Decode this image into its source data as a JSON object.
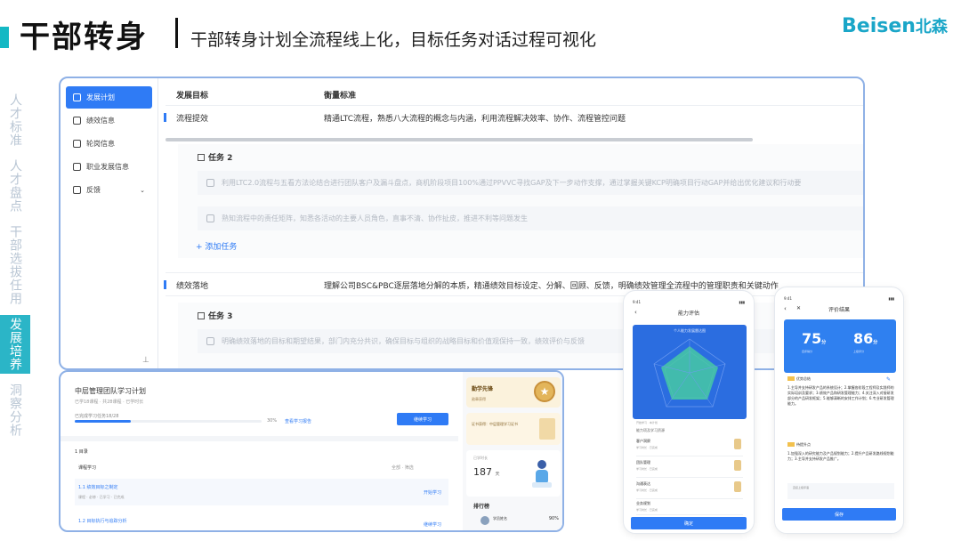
{
  "header": {
    "title": "干部转身",
    "subtitle": "干部转身计划全流程线上化，目标任务对话过程可视化",
    "logo_en": "Beisen",
    "logo_cn": "北森"
  },
  "vnav": [
    {
      "label": "人才标准",
      "active": false
    },
    {
      "label": "人才盘点",
      "active": false
    },
    {
      "label": "干部选拔任用",
      "active": false
    },
    {
      "label": "发展培养",
      "active": true
    },
    {
      "label": "洞察分析",
      "active": false
    }
  ],
  "main": {
    "sidebar": [
      {
        "label": "发展计划",
        "icon": "target-icon",
        "active": true
      },
      {
        "label": "绩效信息",
        "icon": "chart-icon",
        "active": false
      },
      {
        "label": "轮岗信息",
        "icon": "rotate-icon",
        "active": false
      },
      {
        "label": "职业发展信息",
        "icon": "career-icon",
        "active": false
      },
      {
        "label": "反馈",
        "icon": "feedback-icon",
        "active": false
      }
    ],
    "columns": {
      "goal": "发展目标",
      "standard": "衡量标准"
    },
    "rows": [
      {
        "goal": "流程提效",
        "standard": "精通LTC流程，熟悉八大流程的概念与内涵，利用流程解决效率、协作、流程管控问题",
        "task_title": "任务 2",
        "tasks": [
          "利用LTC2.0流程与五看方法论结合进行团队客户及漏斗盘点，商机阶段项目100%通过PPVVC寻找GAP及下一步动作支撑，通过掌握关键KCP明确项目行动GAP并给出优化建议和行动要",
          "熟知流程中的责任矩阵，知悉各活动的主要人员角色，直事不清、协作扯皮，推进不利等问题发生"
        ],
        "add_task": "添加任务"
      },
      {
        "goal": "绩效落地",
        "standard": "理解公司BSC&PBC逐层落地分解的本质，精通绩效目标设定、分解、回顾、反馈，明确绩效管理全流程中的管理职责和关键动作",
        "task_title": "任务 3",
        "tasks": [
          "明确绩效落地的目标和期望结果，部门内充分共识，确保目标与组织的战略目标和价值观保持一致，绩效评价与反馈"
        ]
      }
    ]
  },
  "plan": {
    "title": "中层管理团队学习计划",
    "meta": "已学18课程 · 共28课程 · 已学时长",
    "progress_label": "已完成学习任务18/28",
    "progress": 0.3,
    "progress_pct": "30%",
    "link": "查看学习报告",
    "button": "继续学习",
    "section": "1 目录",
    "learn_label": "课程学习",
    "filter": "全部 · 筛选",
    "items": [
      {
        "title": "1.1 绩效目标之制定",
        "meta": "课程 · 必修 · 已学习 · 已完成",
        "action": "开始学习"
      },
      {
        "title": "1.2 目标执行与追踪分析",
        "meta": "",
        "action": "继续学习"
      }
    ],
    "right": {
      "badge_title": "勤学先锋",
      "badge_sub": "勋章获得",
      "cert_text": "证书获得：中层管理学习证书",
      "stat_label": "已学时长",
      "stat_value": "187",
      "stat_unit": "天",
      "rank_title": "排行榜",
      "rank_name": "学员姓名",
      "rank_pct": "90%"
    }
  },
  "phone1": {
    "time": "9:41",
    "nav_title": "能力评估",
    "radar_title": "个人能力发展雷达图",
    "tag": "开始学习 · 本计划",
    "row_title": "能力项及学习资源",
    "items": [
      {
        "name": "客户洞察",
        "sub": "学习时长 · 已完成"
      },
      {
        "name": "团队管理",
        "sub": "学习时长 · 已完成"
      },
      {
        "name": "沟通表达",
        "sub": "学习时长 · 已完成"
      },
      {
        "name": "业务规划",
        "sub": "学习时长 · 已完成"
      }
    ],
    "button": "确定"
  },
  "phone2": {
    "time": "9:41",
    "nav_title": "评价结果",
    "scores": [
      {
        "value": "75",
        "unit": "分",
        "label": "自评得分"
      },
      {
        "value": "86",
        "unit": "分",
        "label": "上级评分"
      }
    ],
    "sec1": "优势总结",
    "text1": "1.主导并支持研发产品的系统设计；2.掌握各阶段工程师及实践师的实际培训及要求；3.绩效产品和研发管理能力；4.关注深入对接研发部分的产品研发框架；5.能够清晰的安排工作计划；6.专业研发管理能力。",
    "sec2": "待提升点",
    "text2": "1.加强深入的研究能力及产品规划能力；2.提升产品研发路线规划能力；3.主导并支持研发产品推广。",
    "note": "直接上级评语",
    "button": "保存"
  }
}
